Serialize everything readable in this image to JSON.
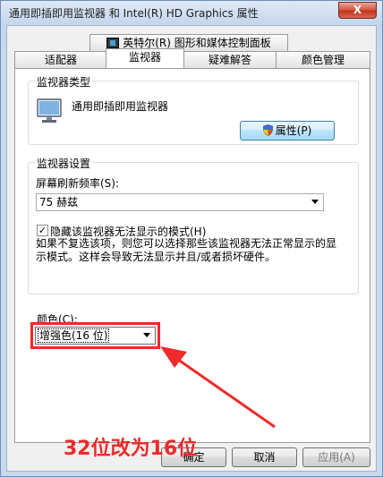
{
  "window": {
    "title": "通用即插即用监视器 和 Intel(R) HD Graphics 属性",
    "close_label": "X"
  },
  "tabs": {
    "top": "英特尔(R) 图形和媒体控制面板",
    "row": [
      "适配器",
      "监视器",
      "疑难解答",
      "颜色管理"
    ],
    "active": "监视器"
  },
  "monitor_type": {
    "group_title": "监视器类型",
    "name": "通用即插即用监视器",
    "properties_label": "属性(P)"
  },
  "monitor_settings": {
    "group_title": "监视器设置",
    "refresh_label": "屏幕刷新频率(S):",
    "refresh_value": "75 赫兹",
    "hide_modes_label": "隐藏该监视器无法显示的模式(H)",
    "hide_modes_checked": true,
    "description": "如果不复选该项，则您可以选择那些该监视器无法正常显示的显示模式。这样会导致无法显示并且/或者损坏硬件。"
  },
  "colors": {
    "label": "颜色(C):",
    "value": "增强色(16 位)"
  },
  "annotation": {
    "text": "32位改为16位",
    "color": "#ee2a2a"
  },
  "footer": {
    "ok_label": "确定",
    "cancel_label": "取消",
    "apply_label": "应用(A)"
  }
}
